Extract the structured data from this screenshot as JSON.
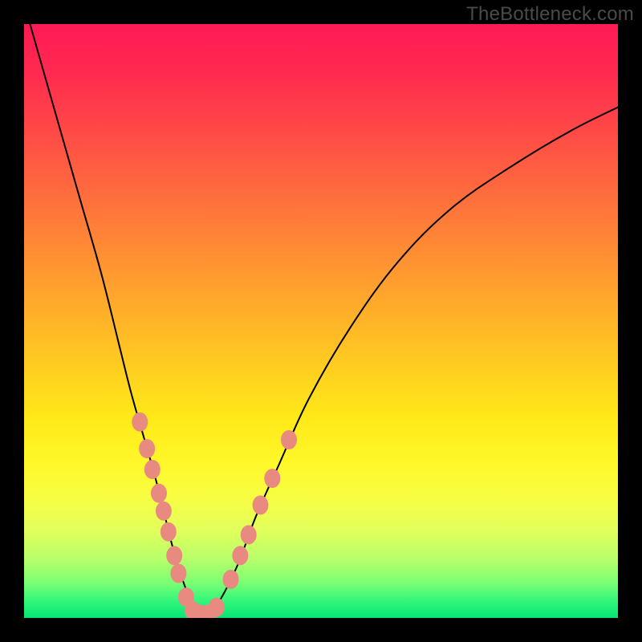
{
  "watermark": "TheBottleneck.com",
  "colors": {
    "background": "#000000",
    "curve": "#000000",
    "marker_fill": "#e88a80",
    "marker_stroke": "#c56a60"
  },
  "chart_data": {
    "type": "line",
    "title": "",
    "xlabel": "",
    "ylabel": "",
    "xlim": [
      0,
      100
    ],
    "ylim": [
      0,
      100
    ],
    "note": "No axes, ticks, or labels are rendered; values are percentage positions across the plot area (0=left/bottom, 100=right/top). y corresponds to bottleneck severity (100=top/red ~ high, 0=bottom/green ~ none).",
    "series": [
      {
        "name": "bottleneck-curve",
        "x": [
          1,
          5,
          9,
          13,
          16,
          18,
          20,
          22,
          23.5,
          25,
          26.5,
          28,
          29.5,
          31,
          33,
          36,
          39,
          43,
          48,
          55,
          63,
          72,
          82,
          92,
          100
        ],
        "y": [
          100,
          86,
          72,
          58,
          46,
          38,
          31,
          24,
          18,
          12,
          7,
          3,
          0.5,
          0.5,
          3,
          9,
          17,
          26,
          37,
          49,
          60,
          69,
          76,
          82,
          86
        ]
      }
    ],
    "markers": {
      "name": "highlighted-points",
      "points": [
        {
          "x": 19.5,
          "y": 33
        },
        {
          "x": 20.7,
          "y": 28.5
        },
        {
          "x": 21.6,
          "y": 25
        },
        {
          "x": 22.7,
          "y": 21
        },
        {
          "x": 23.5,
          "y": 18
        },
        {
          "x": 24.3,
          "y": 14.5
        },
        {
          "x": 25.3,
          "y": 10.5
        },
        {
          "x": 26.0,
          "y": 7.5
        },
        {
          "x": 27.3,
          "y": 3.5
        },
        {
          "x": 28.4,
          "y": 1.2
        },
        {
          "x": 29.8,
          "y": 0.6
        },
        {
          "x": 31.2,
          "y": 0.7
        },
        {
          "x": 32.4,
          "y": 1.8
        },
        {
          "x": 34.8,
          "y": 6.5
        },
        {
          "x": 36.4,
          "y": 10.5
        },
        {
          "x": 37.8,
          "y": 14
        },
        {
          "x": 39.8,
          "y": 19
        },
        {
          "x": 41.8,
          "y": 23.5
        },
        {
          "x": 44.6,
          "y": 30
        }
      ]
    }
  }
}
